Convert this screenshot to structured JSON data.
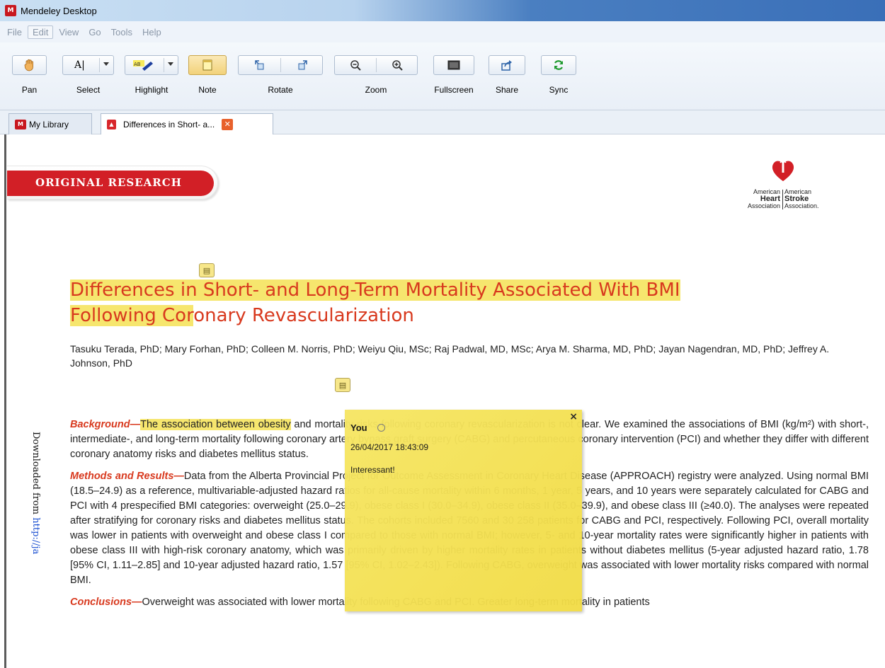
{
  "window": {
    "title": "Mendeley Desktop"
  },
  "menu": {
    "items": [
      "File",
      "Edit",
      "View",
      "Go",
      "Tools",
      "Help"
    ]
  },
  "toolbar": {
    "pan": "Pan",
    "select": "Select",
    "highlight": "Highlight",
    "note": "Note",
    "rotate": "Rotate",
    "zoom": "Zoom",
    "fullscreen": "Fullscreen",
    "share": "Share",
    "sync": "Sync"
  },
  "tabs": [
    {
      "label": "My Library"
    },
    {
      "label": "Differences in Short- a..."
    }
  ],
  "document": {
    "banner": "ORIGINAL RESEARCH",
    "logo": {
      "left": [
        "American",
        "Heart",
        "Association"
      ],
      "right": [
        "American",
        "Stroke",
        "Association."
      ]
    },
    "title_line1_hl": "Differences in Short- and Long-Term Mortality Associated With BMI",
    "title_line2_hl": "Following Cor",
    "title_line2_rest": "onary Revascularization",
    "authors": "Tasuku Terada, PhD; Mary Forhan, PhD; Colleen M. Norris, PhD; Weiyu Qiu, MSc; Raj Padwal, MD, MSc; Arya M. Sharma, MD, PhD; Jayan Nagendran, MD, PhD; Jeffrey A. Johnson, PhD",
    "background_head": "Background—",
    "background_hl": "The association between obesity",
    "background_rest": " and mortality risks following coronary revascularization is not clear. We examined the associations of BMI (kg/m²) with short-, intermediate-, and long-term mortality following coronary artery bypass graft surgery (CABG) and percutaneous coronary intervention (PCI) and whether they differ with different coronary anatomy risks and diabetes mellitus status.",
    "methods_head": "Methods and Results—",
    "methods_text": "Data from the Alberta Provincial Project for Outcome Assessment in Coronary Heart Disease (APPROACH) registry were analyzed. Using normal BMI (18.5–24.9) as a reference, multivariable-adjusted hazard ratios for all-cause mortality within 6 months, 1 year, 5 years, and 10 years were separately calculated for CABG and PCI with 4 prespecified BMI categories: overweight (25.0–29.9), obese class I (30.0–34.9), obese class II (35.0–39.9), and obese class III (≥40.0). The analyses were repeated after stratifying for coronary risks and diabetes mellitus status. The cohorts included 7560 and 30 258 patients for CABG and PCI, respectively. Following PCI, overall mortality was lower in patients with overweight and obese class I compared to those with normal BMI; however, 5- and 10-year mortality rates were significantly higher in patients with obese class III with high-risk coronary anatomy, which was primarily driven by higher mortality rates in patients without diabetes mellitus (5-year adjusted hazard ratio, 1.78 [95% CI, 1.11–2.85] and 10-year adjusted hazard ratio, 1.57 [95% CI, 1.02–2.43]). Following CABG, overweight was associated with lower mortality risks compared with normal BMI.",
    "conclusions_head": "Conclusions—",
    "conclusions_text": "Overweight was associated with lower mortality following CABG and PCI. Greater long-term mortality in patients",
    "side_prefix": "Downloaded from ",
    "side_link": "http://ja"
  },
  "note": {
    "author": "You",
    "date": "26/04/2017 18:43:09",
    "text": "Interessant!",
    "close": "×"
  },
  "colors": {
    "accent_red": "#d8391e",
    "highlight": "#f6e66e",
    "sticky": "#f2dc46"
  }
}
